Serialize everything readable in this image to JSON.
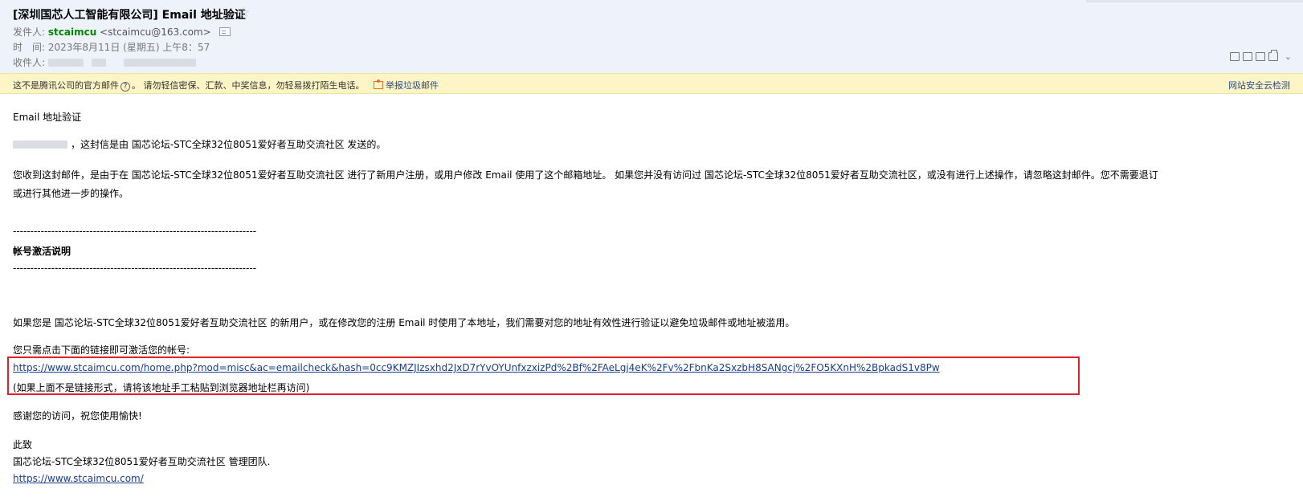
{
  "header": {
    "subject": "[深圳国芯人工智能有限公司] Email 地址验证",
    "from_label": "发件人:",
    "from_name": "stcaimcu",
    "from_email": "<stcaimcu@163.com>",
    "time_label": "时　间:",
    "time_value": "2023年8月11日 (星期五) 上午8：57",
    "to_label": "收件人:"
  },
  "warning": {
    "text_before": "这不是腾讯公司的官方邮件",
    "text_after": "。 请勿轻信密保、汇款、中奖信息，勿轻易拨打陌生电话。",
    "report": "举报垃圾邮件",
    "cloud_check": "网站安全云检测"
  },
  "email": {
    "title": "Email 地址验证",
    "greeting": "，这封信是由 国芯论坛-STC全球32位8051爱好者互助交流社区 发送的。",
    "p1_line1": "您收到这封邮件，是由于在 国芯论坛-STC全球32位8051爱好者互助交流社区 进行了新用户注册，或用户修改 Email 使用了这个邮箱地址。 如果您并没有访问过 国芯论坛-STC全球32位8051爱好者互助交流社区，或没有进行上述操作，请忽略这封邮件。您不需要退订",
    "p1_line2": "或进行其他进一步的操作。",
    "divider": "----------------------------------------------------------------------",
    "section_title": "帐号激活说明",
    "p2": "如果您是 国芯论坛-STC全球32位8051爱好者互助交流社区 的新用户，或在修改您的注册 Email 时使用了本地址，我们需要对您的地址有效性进行验证以避免垃圾邮件或地址被滥用。",
    "p3": "您只需点击下面的链接即可激活您的帐号:",
    "activation_link": "https://www.stcaimcu.com/home.php?mod=misc&ac=emailcheck&hash=0cc9KMZJIzsxhd2JxD7rYvOYUnfxzxizPd%2Bf%2FAeLgj4eK%2Fv%2FbnKa2SxzbH8SANgcj%2FO5KXnH%2BpkadS1v8Pw",
    "link_note": "(如果上面不是链接形式，请将该地址手工粘贴到浏览器地址栏再访问)",
    "thanks": "感谢您的访问，祝您使用愉快!",
    "closing": "此致",
    "team": "国芯论坛-STC全球32位8051爱好者互助交流社区 管理团队.",
    "site_link": "https://www.stcaimcu.com/"
  },
  "icons": {
    "star": "star-icon",
    "card": "contact-card-icon",
    "help": "question-icon",
    "report": "report-icon"
  }
}
